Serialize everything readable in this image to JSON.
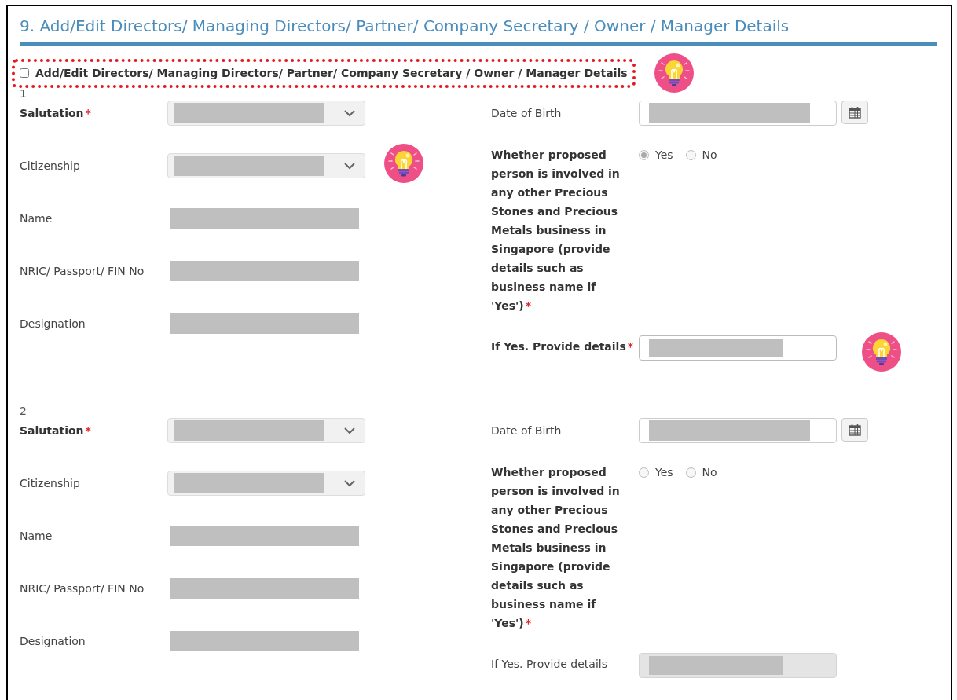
{
  "section_title": "9. Add/Edit Directors/ Managing Directors/ Partner/ Company Secretary / Owner / Manager Details",
  "required_mark": "*",
  "toggle": {
    "label": "Add/Edit Directors/ Managing Directors/ Partner/ Company Secretary / Owner / Manager Details",
    "checked": false,
    "tip": true
  },
  "persons": [
    {
      "number": "1",
      "fields": [
        {
          "kind": "select",
          "label": "Salutation",
          "required": true,
          "tip": false
        },
        {
          "kind": "select",
          "label": "Citizenship",
          "required": false,
          "tip": true
        },
        {
          "kind": "text",
          "label": "Name",
          "required": false,
          "tip": false
        },
        {
          "kind": "text",
          "label": "NRIC/ Passport/ FIN No",
          "required": false,
          "tip": false
        },
        {
          "kind": "text",
          "label": "Designation",
          "required": false,
          "tip": false
        }
      ],
      "date_of_birth": {
        "label": "Date of Birth"
      },
      "involvement": {
        "label": "Whether proposed person is involved in any other Precious Stones and Precious Metals business in Singapore (provide details such as business name if 'Yes')",
        "required": true,
        "options": [
          {
            "label": "Yes",
            "selected": true
          },
          {
            "label": "No",
            "selected": false
          }
        ]
      },
      "details": {
        "label": "If Yes. Provide details",
        "required": true,
        "disabled": false,
        "tip": true
      }
    },
    {
      "number": "2",
      "fields": [
        {
          "kind": "select",
          "label": "Salutation",
          "required": true,
          "tip": false
        },
        {
          "kind": "select",
          "label": "Citizenship",
          "required": false,
          "tip": false
        },
        {
          "kind": "text",
          "label": "Name",
          "required": false,
          "tip": false
        },
        {
          "kind": "text",
          "label": "NRIC/ Passport/ FIN No",
          "required": false,
          "tip": false
        },
        {
          "kind": "text",
          "label": "Designation",
          "required": false,
          "tip": false
        }
      ],
      "date_of_birth": {
        "label": "Date of Birth"
      },
      "involvement": {
        "label": "Whether proposed person is involved in any other Precious Stones and Precious Metals business in Singapore (provide details such as business name if 'Yes')",
        "required": true,
        "options": [
          {
            "label": "Yes",
            "selected": false
          },
          {
            "label": "No",
            "selected": false
          }
        ]
      },
      "details": {
        "label": "If Yes. Provide details",
        "required": false,
        "disabled": true,
        "tip": false
      }
    }
  ]
}
